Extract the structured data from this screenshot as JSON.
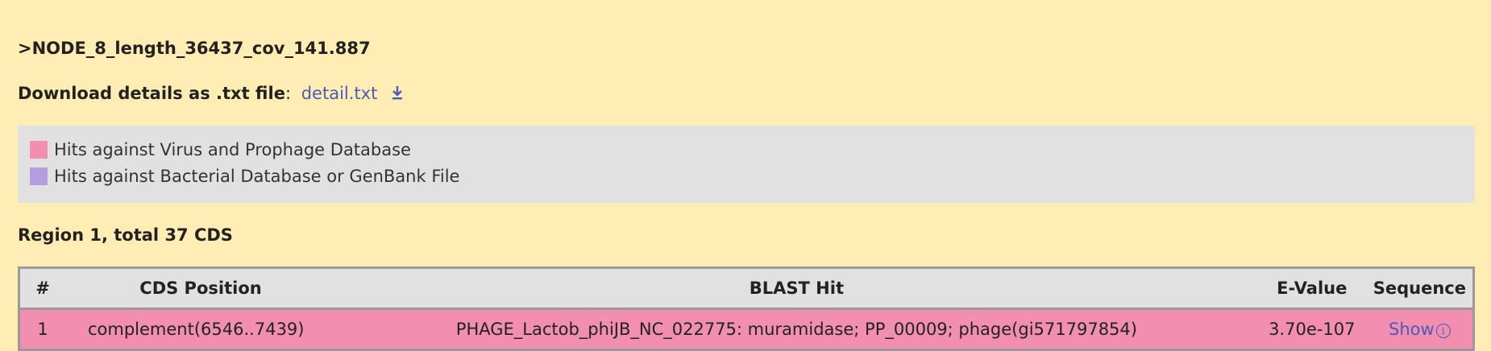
{
  "node_title": ">NODE_8_length_36437_cov_141.887",
  "download": {
    "label": "Download details as .txt file",
    "separator": ":",
    "link_text": "detail.txt"
  },
  "legend": {
    "items": [
      {
        "label": "Hits against Virus and Prophage Database",
        "color": "#f28fb0"
      },
      {
        "label": "Hits against Bacterial Database or GenBank File",
        "color": "#b49de0"
      }
    ]
  },
  "region": {
    "title": "Region 1, total 37 CDS"
  },
  "table": {
    "headers": {
      "num": "#",
      "position": "CDS Position",
      "blast": "BLAST Hit",
      "evalue": "E-Value",
      "sequence": "Sequence"
    },
    "rows": [
      {
        "num": "1",
        "position": "complement(6546..7439)",
        "blast": "PHAGE_Lactob_phiJB_NC_022775: muramidase; PP_00009; phage(gi571797854)",
        "evalue": "3.70e-107",
        "sequence_link": "Show",
        "row_color": "#f28fb0"
      }
    ]
  },
  "colors": {
    "background": "#ffedb3",
    "link": "#4a5bb8",
    "panel": "#e1e1e1"
  },
  "icons": [
    "download-icon",
    "info-icon"
  ]
}
